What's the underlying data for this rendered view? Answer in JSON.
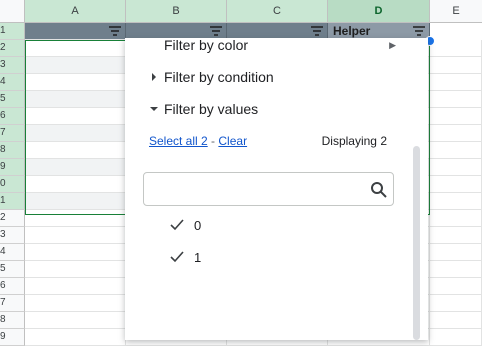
{
  "columns": [
    "A",
    "B",
    "C",
    "D",
    "E"
  ],
  "row_numbers": [
    "1",
    "2",
    "3",
    "4",
    "5",
    "6",
    "7",
    "8",
    "9",
    "0",
    "1",
    "2",
    "3",
    "4",
    "5",
    "6",
    "7",
    "8",
    "9"
  ],
  "header_row": {
    "d_label": "Helper"
  },
  "filter_menu": {
    "items": [
      {
        "label": "Filter by color",
        "caret": "none"
      },
      {
        "label": "Filter by condition",
        "caret": "right"
      },
      {
        "label": "Filter by values",
        "caret": "down"
      }
    ],
    "select_all_label": "Select all 2",
    "separator": "-",
    "clear_label": "Clear",
    "displaying_text": "Displaying 2",
    "search_placeholder": "",
    "values": [
      {
        "label": "0",
        "checked": true
      },
      {
        "label": "1",
        "checked": true
      }
    ]
  },
  "colors": {
    "selected_column_header": "#c9e7d3",
    "header_row_fill": "#6f7f8c",
    "link": "#1155cc",
    "selection_border": "#188038"
  },
  "icons": {
    "filter": "filter-icon",
    "search": "search-icon",
    "check": "checkmark-icon",
    "caret_right": "caret-right-icon",
    "caret_down": "caret-down-icon",
    "submenu_arrow": "submenu-arrow-icon"
  }
}
